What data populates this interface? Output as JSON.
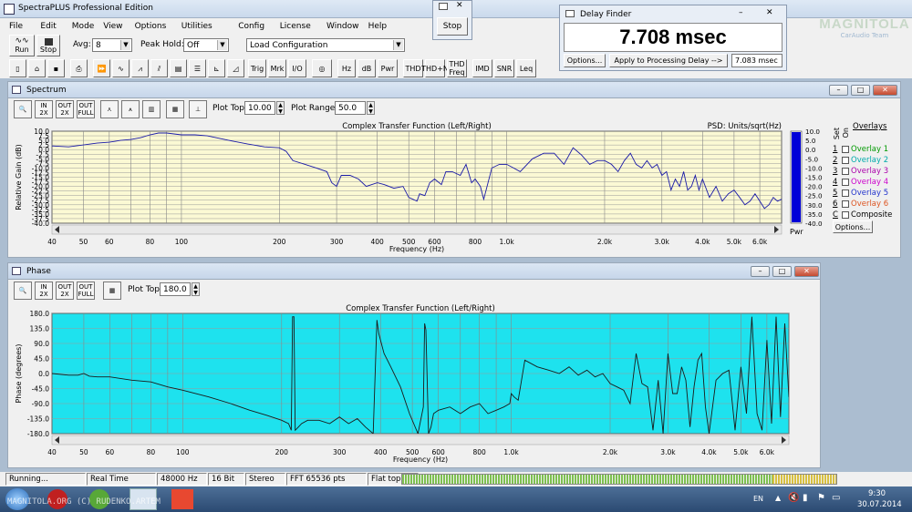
{
  "app": {
    "title": "SpectraPLUS Professional Edition"
  },
  "menu": [
    "File",
    "Edit",
    "Mode",
    "View",
    "Options",
    "Utilities",
    "Config",
    "License",
    "Window",
    "Help"
  ],
  "toolbar": {
    "run_label": "Run",
    "stop_label": "Stop",
    "avg_label": "Avg:",
    "avg_value": "8",
    "peak_hold_label": "Peak Hold:",
    "peak_hold_value": "Off",
    "config_value": "Load Configuration",
    "buttons": [
      "Hz",
      "dB",
      "Pwr",
      "THD",
      "THD+N",
      "THD Freq",
      "IMD",
      "SNR",
      "Leq"
    ],
    "small_icons": [
      "Trig",
      "Mrk",
      "I/O"
    ]
  },
  "stop_popup": {
    "label": "Stop"
  },
  "delay_finder": {
    "title": "Delay Finder",
    "value": "7.708 msec",
    "options_label": "Options...",
    "apply_label": "Apply to Processing Delay -->",
    "applied_value": "7.083 msec"
  },
  "watermark": {
    "brand": "MAGNITOLA",
    "sub": "CarAudio Team"
  },
  "spectrum": {
    "window_title": "Spectrum",
    "plot_top_label": "Plot Top:",
    "plot_top_value": "10.00",
    "plot_range_label": "Plot Range:",
    "plot_range_value": "50.0",
    "pwr_label": "Pwr",
    "overlays_title": "Overlays",
    "set_label": "Set",
    "on_label": "On",
    "overlays": [
      {
        "num": "1",
        "name": "Overlay 1",
        "color": "#009900"
      },
      {
        "num": "2",
        "name": "Overlay 2",
        "color": "#00aaaa"
      },
      {
        "num": "3",
        "name": "Overlay 3",
        "color": "#aa00aa"
      },
      {
        "num": "4",
        "name": "Overlay 4",
        "color": "#cc00cc"
      },
      {
        "num": "5",
        "name": "Overlay 5",
        "color": "#2233cc"
      },
      {
        "num": "6",
        "name": "Overlay 6",
        "color": "#dd5522"
      },
      {
        "num": "C",
        "name": "Composite",
        "color": "#000000"
      }
    ],
    "options_label": "Options..."
  },
  "phase": {
    "window_title": "Phase",
    "plot_top_label": "Plot Top:",
    "plot_top_value": "180.0"
  },
  "status": {
    "cells": [
      "Running...",
      "Real Time",
      "48000 Hz",
      "16 Bit",
      "Stereo",
      "FFT 65536 pts",
      "Flat top"
    ]
  },
  "taskbar": {
    "lang": "EN",
    "time": "9:30",
    "date": "30.07.2014",
    "watermark_text": "MAGNITOLA.ORG (C) RUDENKO.ARTEM"
  },
  "chart_data": [
    {
      "type": "line",
      "title": "Complex Transfer Function (Left/Right)",
      "subtitle": "PSD: Units/sqrt(Hz)",
      "xlabel": "Frequency (Hz)",
      "ylabel": "Relative Gain (dB)",
      "x_scale": "log",
      "xlim": [
        40,
        7000
      ],
      "ylim": [
        -40,
        10
      ],
      "x_ticks": [
        "40",
        "50",
        "60",
        "80",
        "100",
        "200",
        "300",
        "400",
        "500",
        "600",
        "800",
        "1.0k",
        "2.0k",
        "3.0k",
        "4.0k",
        "5.0k",
        "6.0k"
      ],
      "y_ticks": [
        "10.0",
        "7.5",
        "5.0",
        "2.5",
        "0.0",
        "-2.5",
        "-5.0",
        "-7.5",
        "-10.0",
        "-12.5",
        "-15.0",
        "-17.5",
        "-20.0",
        "-22.5",
        "-25.0",
        "-27.5",
        "-30.0",
        "-32.5",
        "-35.0",
        "-37.5",
        "-40.0"
      ],
      "color_bar_ticks": [
        "10.0",
        "5.0",
        "0.0",
        "-5.0",
        "-10.0",
        "-15.0",
        "-20.0",
        "-25.0",
        "-30.0",
        "-35.0",
        "-40.0"
      ],
      "grid": true,
      "series": [
        {
          "x": [
            40,
            45,
            50,
            55,
            60,
            65,
            70,
            75,
            80,
            85,
            90,
            100,
            110,
            120,
            140,
            160,
            180,
            200,
            210,
            220,
            240,
            260,
            280,
            290,
            300,
            310,
            330,
            350,
            370,
            400,
            420,
            450,
            480,
            500,
            530,
            540,
            560,
            580,
            600,
            630,
            650,
            680,
            700,
            720,
            750,
            780,
            800,
            830,
            850,
            900,
            950,
            1000,
            1050,
            1100,
            1200,
            1300,
            1400,
            1500,
            1600,
            1700,
            1800,
            1900,
            2000,
            2100,
            2200,
            2300,
            2400,
            2500,
            2600,
            2700,
            2800,
            2900,
            3000,
            3100,
            3200,
            3300,
            3400,
            3500,
            3600,
            3700,
            3800,
            3900,
            4000,
            4200,
            4400,
            4600,
            4800,
            5000,
            5200,
            5400,
            5600,
            5800,
            6000,
            6200,
            6400,
            6600,
            6800,
            7000
          ],
          "y": [
            2,
            1.5,
            2.5,
            3.5,
            4,
            5,
            5.5,
            6.5,
            8,
            9,
            9,
            8,
            8,
            7.5,
            5,
            3,
            1.5,
            1,
            -1,
            -6,
            -8,
            -10,
            -12,
            -18,
            -20,
            -14,
            -14,
            -16,
            -20,
            -18,
            -19,
            -21,
            -20,
            -26,
            -28,
            -24,
            -25,
            -18,
            -16,
            -19,
            -12,
            -12,
            -13,
            -14,
            -8,
            -18,
            -16,
            -20,
            -27,
            -10,
            -8,
            -8,
            -10,
            -12,
            -5,
            -2,
            -2,
            -8,
            1,
            -3,
            -8,
            -6,
            -6,
            -8,
            -12,
            -6,
            -2,
            -8,
            -10,
            -6,
            -10,
            -8,
            -14,
            -12,
            -22,
            -16,
            -20,
            -12,
            -22,
            -20,
            -14,
            -22,
            -16,
            -26,
            -20,
            -28,
            -24,
            -22,
            -26,
            -30,
            -28,
            -24,
            -28,
            -32,
            -30,
            -26,
            -28,
            -27
          ]
        }
      ]
    },
    {
      "type": "line",
      "title": "Complex Transfer Function (Left/Right)",
      "xlabel": "Frequency (Hz)",
      "ylabel": "Phase (degrees)",
      "x_scale": "log",
      "xlim": [
        40,
        7000
      ],
      "ylim": [
        -180,
        180
      ],
      "x_ticks": [
        "40",
        "50",
        "60",
        "80",
        "100",
        "200",
        "300",
        "400",
        "500",
        "600",
        "800",
        "1.0k",
        "2.0k",
        "3.0k",
        "4.0k",
        "5.0k",
        "6.0k"
      ],
      "y_ticks": [
        "180.0",
        "135.0",
        "90.0",
        "45.0",
        "0.0",
        "-45.0",
        "-90.0",
        "-135.0",
        "-180.0"
      ],
      "grid": true,
      "series": [
        {
          "x": [
            40,
            45,
            48,
            50,
            52,
            55,
            60,
            70,
            80,
            90,
            100,
            120,
            140,
            160,
            180,
            200,
            210,
            214,
            216,
            218,
            220,
            225,
            230,
            240,
            260,
            280,
            300,
            320,
            340,
            360,
            380,
            390,
            395,
            400,
            410,
            430,
            460,
            490,
            520,
            540,
            545,
            550,
            560,
            570,
            580,
            600,
            650,
            700,
            750,
            800,
            850,
            900,
            950,
            990,
            1000,
            1020,
            1050,
            1100,
            1200,
            1300,
            1400,
            1500,
            1600,
            1700,
            1800,
            1900,
            2000,
            2100,
            2200,
            2300,
            2400,
            2500,
            2600,
            2700,
            2800,
            2900,
            3000,
            3100,
            3200,
            3300,
            3400,
            3500,
            3600,
            3700,
            3800,
            3900,
            4000,
            4200,
            4400,
            4600,
            4800,
            5000,
            5200,
            5400,
            5600,
            5800,
            6000,
            6200,
            6400,
            6600,
            6800,
            7000
          ],
          "y": [
            0,
            -5,
            -5,
            0,
            -8,
            -10,
            -10,
            -20,
            -25,
            -40,
            -50,
            -70,
            -90,
            -110,
            -125,
            -140,
            -150,
            -170,
            170,
            170,
            -170,
            -160,
            -150,
            -140,
            -140,
            -150,
            -130,
            -150,
            -135,
            -160,
            -180,
            160,
            120,
            100,
            60,
            20,
            -40,
            -120,
            -180,
            -100,
            150,
            130,
            -180,
            -160,
            -120,
            -110,
            -100,
            -120,
            -100,
            -90,
            -120,
            -110,
            -100,
            -90,
            -60,
            -70,
            -80,
            40,
            20,
            10,
            0,
            20,
            -5,
            10,
            -10,
            0,
            -30,
            -40,
            -50,
            -90,
            60,
            -30,
            -40,
            -170,
            -20,
            -180,
            60,
            -60,
            -60,
            20,
            -20,
            -160,
            -40,
            40,
            60,
            -100,
            -180,
            -20,
            0,
            10,
            -170,
            20,
            -120,
            170,
            -120,
            -170,
            100,
            -150,
            170,
            -130,
            150,
            -70
          ]
        }
      ]
    }
  ]
}
